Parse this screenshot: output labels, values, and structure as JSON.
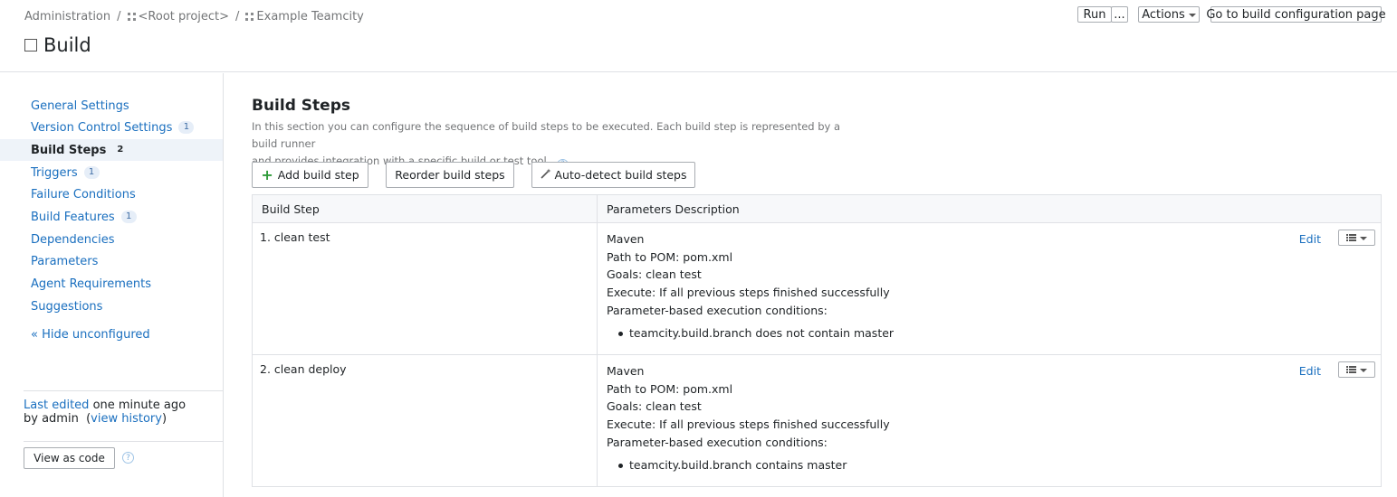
{
  "breadcrumb": {
    "administration": "Administration",
    "sep": "/",
    "root_project": "<Root project>",
    "project": "Example Teamcity"
  },
  "title": "Build",
  "header_buttons": {
    "run": "Run",
    "more": "...",
    "actions": "Actions",
    "goto_config": "Go to build configuration page"
  },
  "sidebar": {
    "items": [
      {
        "label": "General Settings",
        "count": ""
      },
      {
        "label": "Version Control Settings",
        "count": "1"
      },
      {
        "label": "Build Steps",
        "count": "2"
      },
      {
        "label": "Triggers",
        "count": "1"
      },
      {
        "label": "Failure Conditions",
        "count": ""
      },
      {
        "label": "Build Features",
        "count": "1"
      },
      {
        "label": "Dependencies",
        "count": ""
      },
      {
        "label": "Parameters",
        "count": ""
      },
      {
        "label": "Agent Requirements",
        "count": ""
      },
      {
        "label": "Suggestions",
        "count": ""
      }
    ],
    "hide_unconfigured": "« Hide unconfigured",
    "last_edited_link": "Last edited",
    "last_edited_time": "one minute ago",
    "by_prefix": "by admin",
    "view_history": "view history",
    "view_as_code": "View as code"
  },
  "main": {
    "title": "Build Steps",
    "description_line1": "In this section you can configure the sequence of build steps to be executed. Each build step is represented by a build runner",
    "description_line2": "and provides integration with a specific build or test tool.",
    "add_step": "Add build step",
    "reorder_steps": "Reorder build steps",
    "auto_detect": "Auto-detect build steps",
    "table_headers": [
      "Build Step",
      "Parameters Description"
    ],
    "edit_label": "Edit",
    "steps": [
      {
        "name": "1. clean test",
        "runner": "Maven",
        "pom": "Path to POM: pom.xml",
        "goals": "Goals: clean test",
        "execute": "Execute: If all previous steps finished successfully",
        "conditions_label": "Parameter-based execution conditions:",
        "condition": "teamcity.build.branch does not contain master"
      },
      {
        "name": "2. clean deploy",
        "runner": "Maven",
        "pom": "Path to POM: pom.xml",
        "goals": "Goals: clean test",
        "execute": "Execute: If all previous steps finished successfully",
        "conditions_label": "Parameter-based execution conditions:",
        "condition": "teamcity.build.branch contains master"
      }
    ]
  }
}
